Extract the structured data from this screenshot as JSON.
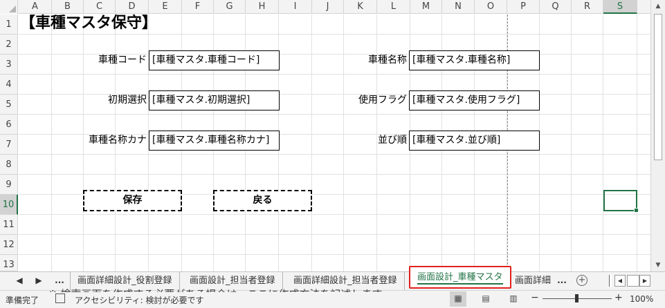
{
  "columns": [
    "A",
    "B",
    "C",
    "D",
    "E",
    "F",
    "G",
    "H",
    "I",
    "J",
    "K",
    "L",
    "M",
    "N",
    "O",
    "P",
    "Q",
    "R",
    "S"
  ],
  "selected_column": "S",
  "rows": [
    "1",
    "2",
    "3",
    "4",
    "5",
    "6",
    "7",
    "8",
    "9",
    "10",
    "11",
    "12",
    "13"
  ],
  "selected_row": "10",
  "title": "【車種マスタ保守】",
  "form": {
    "fields": [
      {
        "label": "車種コード",
        "value": "[車種マスタ.車種コード]"
      },
      {
        "label": "車種名称",
        "value": "[車種マスタ.車種名称]"
      },
      {
        "label": "初期選択",
        "value": "[車種マスタ.初期選択]"
      },
      {
        "label": "使用フラグ",
        "value": "[車種マスタ.使用フラグ]"
      },
      {
        "label": "車種名称カナ",
        "value": "[車種マスタ.車種名称カナ]"
      },
      {
        "label": "並び順",
        "value": "[車種マスタ.並び順]"
      }
    ],
    "save_button": "保存",
    "back_button": "戻る"
  },
  "tabs": {
    "ellipsis": "...",
    "items": [
      {
        "label": "画面詳細設計_役割登録"
      },
      {
        "label": "画面設計_担当者登録"
      },
      {
        "label": "画面詳細設計_担当者登録"
      },
      {
        "label": "画面設計_車種マスタ",
        "active": true
      },
      {
        "label": "画面詳細"
      }
    ],
    "more": "...",
    "add": "+"
  },
  "status": {
    "ready": "準備完了",
    "accessibility": "アクセシビリティ: 検討が必要です",
    "zoom_minus": "−",
    "zoom_plus": "+",
    "zoom": "100%",
    "cutoff_text": "※ 検索画面を作成する必要がある場合は、ここに作成方法を記述します。"
  },
  "icons": {
    "prev_sheet": "left-arrow-icon",
    "next_sheet": "right-arrow-icon",
    "add_sheet": "plus-circle-icon",
    "normal_view": "normal-view-icon",
    "page_layout": "page-layout-icon",
    "page_break": "page-break-preview-icon"
  },
  "colors": {
    "accent": "#217346",
    "active_tab_border": "#e0201c"
  }
}
